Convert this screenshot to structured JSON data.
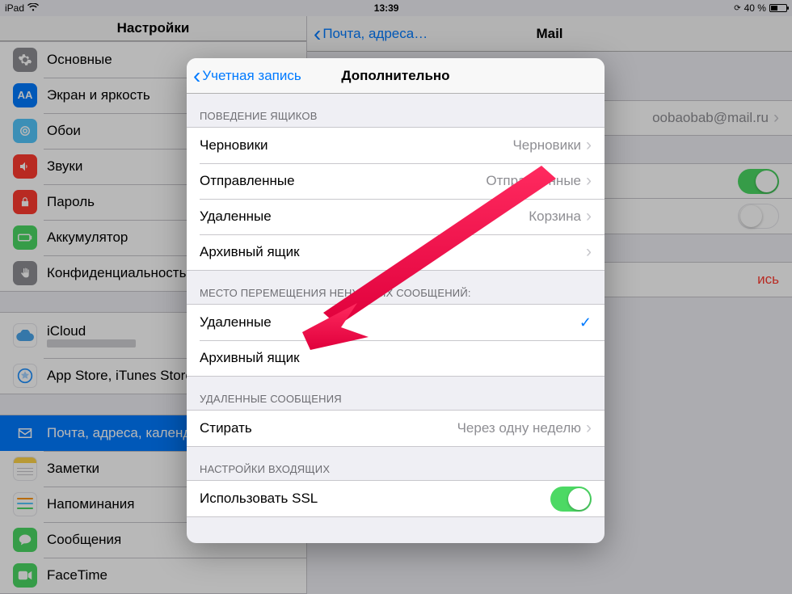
{
  "statusbar": {
    "carrier": "iPad",
    "time": "13:39",
    "battery_text": "40 %"
  },
  "sidebar": {
    "title": "Настройки",
    "items": {
      "general": "Основные",
      "display": "Экран и яркость",
      "wallpaper": "Обои",
      "sounds": "Звуки",
      "passcode": "Пароль",
      "battery": "Аккумулятор",
      "privacy": "Конфиденциальность",
      "icloud": "iCloud",
      "appstore": "App Store, iTunes Store",
      "mail": "Почта, адреса, календари",
      "notes": "Заметки",
      "reminders": "Напоминания",
      "messages": "Сообщения",
      "facetime": "FaceTime"
    }
  },
  "detail": {
    "back_label": "Почта, адреса…",
    "title": "Mail",
    "account_value": "oobaobab@mail.ru",
    "delete_label": "ись"
  },
  "popover": {
    "back_label": "Учетная запись",
    "title": "Дополнительно",
    "section1": "ПОВЕДЕНИЕ ЯЩИКОВ",
    "rows1": {
      "drafts_label": "Черновики",
      "drafts_value": "Черновики",
      "sent_label": "Отправленные",
      "sent_value": "Отправленные",
      "deleted_label": "Удаленные",
      "deleted_value": "Корзина",
      "archive_label": "Архивный ящик"
    },
    "section2": "МЕСТО ПЕРЕМЕЩЕНИЯ НЕНУЖНЫХ СООБЩЕНИЙ:",
    "rows2": {
      "deleted": "Удаленные",
      "archive": "Архивный ящик"
    },
    "section3": "УДАЛЕННЫЕ СООБЩЕНИЯ",
    "rows3": {
      "erase_label": "Стирать",
      "erase_value": "Через одну неделю"
    },
    "section4": "НАСТРОЙКИ ВХОДЯЩИХ",
    "rows4": {
      "ssl_label": "Использовать SSL"
    }
  }
}
